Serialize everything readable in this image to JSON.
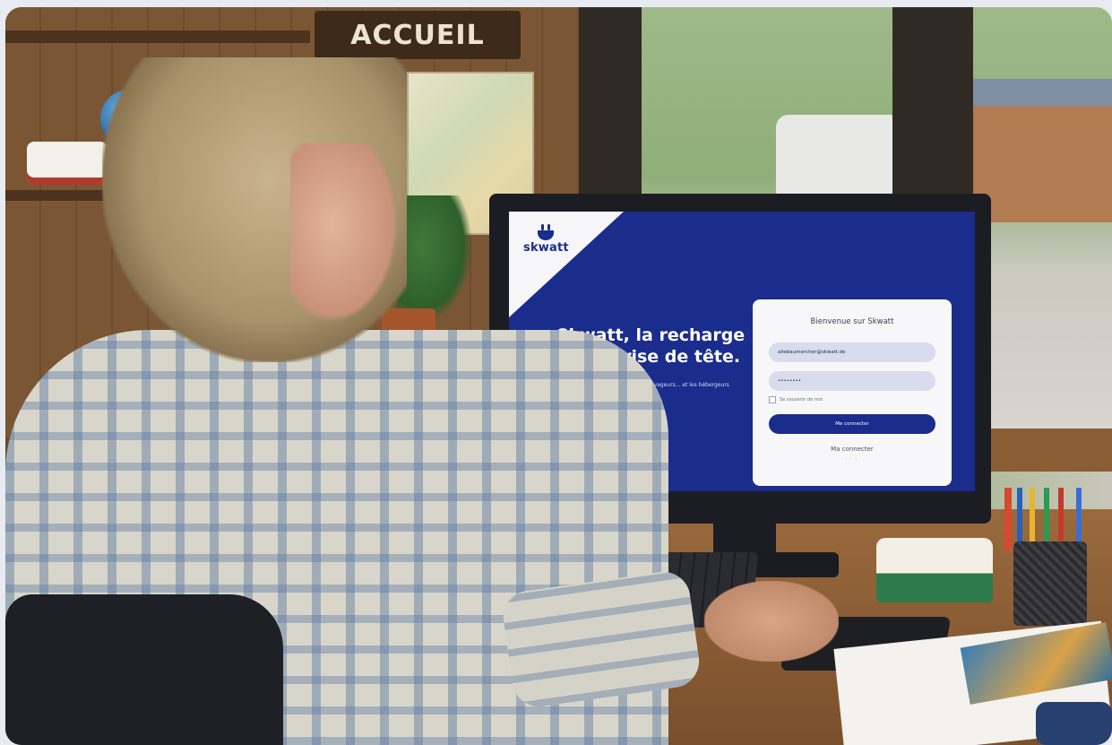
{
  "scene": {
    "wall_sign": "ACCUEIL"
  },
  "screen": {
    "brand": "skwatt",
    "headline_line1": "Skwatt, la recharge",
    "headline_line2": "sans prise de tête.",
    "tagline": "Le service qui branche les voyageurs... et les hébergeurs",
    "colors": {
      "primary": "#1a2c8c",
      "card": "#f7f7f9",
      "field": "#d9dcec"
    },
    "login": {
      "title": "Bienvenue sur Skwatt",
      "email_value": "allebaumercher@skwatt.de",
      "password_value": "••••••••",
      "remember_label": "Se souvenir de moi",
      "submit_label": "Me connecter",
      "secondary_link": "Ma connecter",
      "secondary_sub": "·· ·"
    }
  }
}
